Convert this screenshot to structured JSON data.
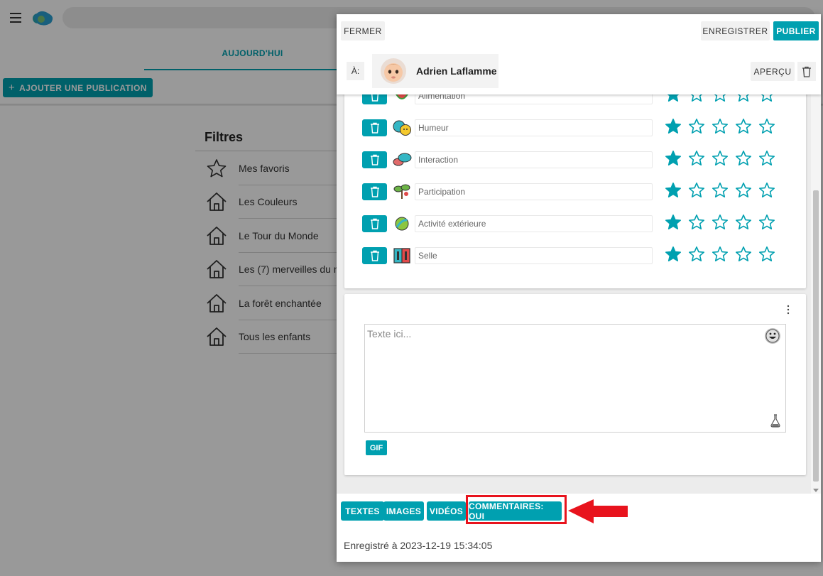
{
  "header_bar": {
    "tabs": [
      "AUJOURD'HUI"
    ],
    "add_publication": "AJOUTER UNE PUBLICATION"
  },
  "filters": {
    "title": "Filtres",
    "items": [
      {
        "label": "Mes favoris",
        "icon": "star-outline-icon"
      },
      {
        "label": "Les Couleurs",
        "icon": "home-icon"
      },
      {
        "label": "Le Tour du Monde",
        "icon": "home-icon"
      },
      {
        "label": "Les (7) merveilles du m",
        "icon": "home-icon"
      },
      {
        "label": "La forêt enchantée",
        "icon": "home-icon"
      },
      {
        "label": "Tous les enfants",
        "icon": "home-icon"
      }
    ]
  },
  "dialog": {
    "close_label": "FERMER",
    "save_label": "ENREGISTRER",
    "publish_label": "PUBLIER",
    "to_label": "À:",
    "recipient_name": "Adrien Laflamme",
    "preview_label": "APERÇU",
    "ratings": [
      {
        "label": "Alimentation",
        "icon": "watermelon-icon",
        "stars": 1
      },
      {
        "label": "Humeur",
        "icon": "mood-faces-icon",
        "stars": 1
      },
      {
        "label": "Interaction",
        "icon": "speech-bubbles-icon",
        "stars": 1
      },
      {
        "label": "Participation",
        "icon": "sprout-icon",
        "stars": 1
      },
      {
        "label": "Activité extérieure",
        "icon": "leaf-ball-icon",
        "stars": 1
      },
      {
        "label": "Selle",
        "icon": "restroom-icon",
        "stars": 1
      }
    ],
    "max_stars": 5,
    "text_placeholder": "Texte ici...",
    "gif_label": "GIF",
    "footer_buttons": {
      "texts": "TEXTES",
      "images": "IMAGES",
      "videos": "VIDÉOS",
      "comments": "COMMENTAIRES: OUI"
    },
    "saved_at": "Enregistré à 2023-12-19 15:34:05"
  },
  "colors": {
    "accent": "#00a0b0",
    "highlight": "#e8131d"
  }
}
